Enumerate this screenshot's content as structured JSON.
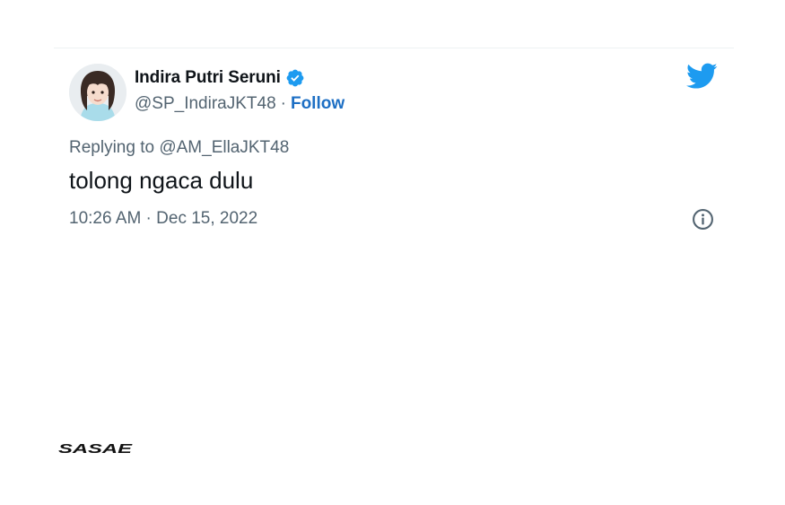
{
  "tweet": {
    "display_name": "Indira Putri Seruni",
    "handle": "@SP_IndiraJKT48",
    "separator": "·",
    "follow_label": "Follow",
    "replying_to": "Replying to @AM_EllaJKT48",
    "text": "tolong ngaca dulu",
    "timestamp": "10:26 AM · Dec 15, 2022",
    "verified": true
  },
  "icons": {
    "logo": "twitter-bird-icon",
    "verified": "verified-badge-icon",
    "info": "info-icon",
    "avatar": "profile-avatar"
  },
  "watermark": {
    "text": "SASAE"
  },
  "colors": {
    "twitter_blue": "#1d9bf0",
    "follow_blue": "#1d6fc4",
    "secondary_text": "#536471",
    "primary_text": "#0f1419"
  }
}
